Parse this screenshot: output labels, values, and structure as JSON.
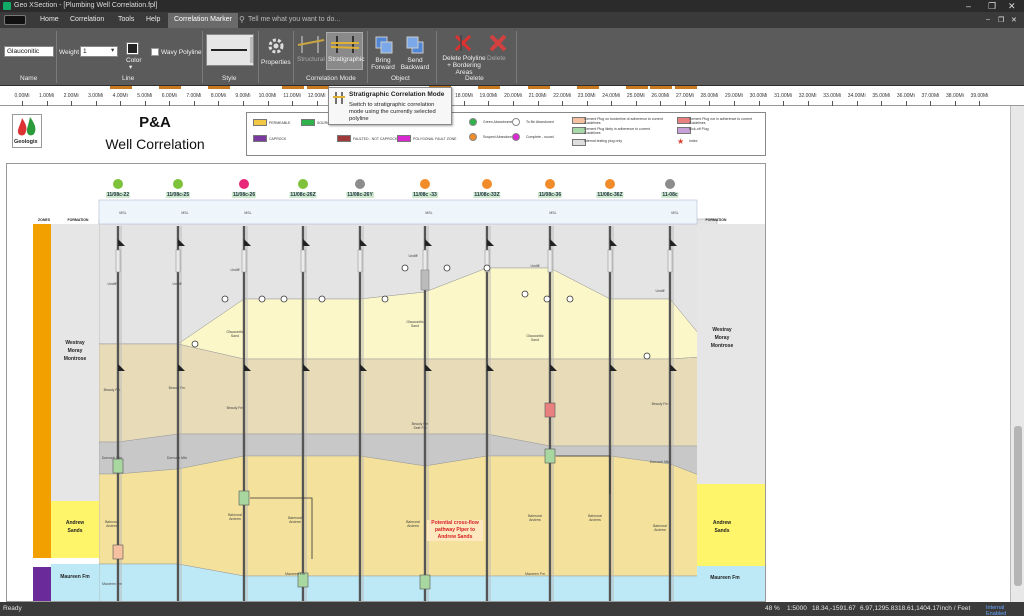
{
  "window": {
    "title": "Geo XSection - [Plumbing Well Correlation.fpl]"
  },
  "menu": {
    "items": [
      "Home",
      "Correlation",
      "Tools",
      "Help"
    ],
    "active_tab": "Correlation Marker",
    "search_placeholder": "Tell me what you want to do..."
  },
  "ribbon": {
    "name_value": "Glauconitic",
    "weight_label": "Weight",
    "weight_value": "1",
    "color_label": "Color",
    "wavy_label": "Wavy Polyline",
    "properties_label": "Properties",
    "structural_label": "Structural",
    "stratigraphic_label": "Stratigraphic",
    "bring_forward_label": "Bring Forward",
    "send_backward_label": "Send Backward",
    "delete_polyline_label": "Delete Polyline + Bordering Areas",
    "delete_label": "Delete",
    "groups": {
      "name": "Name",
      "line": "Line",
      "style": "Style",
      "correlation_mode": "Correlation Mode",
      "object": "Object",
      "delete": "Delete"
    }
  },
  "tooltip": {
    "title": "Stratigraphic Correlation Mode",
    "body": "Switch to stratigraphic correlation mode using the currently selected polyline"
  },
  "ruler": {
    "labels": [
      "0.00Mi",
      "1.00Mi",
      "2.00Mi",
      "3.00Mi",
      "4.00Mi",
      "5.00Mi",
      "6.00Mi",
      "7.00Mi",
      "8.00Mi",
      "9.00Mi",
      "10.00Mi",
      "11.00Mi",
      "12.00Mi",
      "13.00Mi",
      "14.00Mi",
      "15.00Mi",
      "16.00Mi",
      "17.00Mi",
      "18.00Mi",
      "19.00Mi",
      "20.00Mi",
      "21.00Mi",
      "22.00Mi",
      "23.00Mi",
      "24.00Mi",
      "25.00Mi",
      "26.00Mi",
      "27.00Mi",
      "28.00Mi",
      "29.00Mi",
      "30.00Mi",
      "31.00Mi",
      "32.00Mi",
      "33.00Mi",
      "34.00Mi",
      "35.00Mi",
      "36.00Mi",
      "37.00Mi",
      "38.00Mi",
      "39.00Mi"
    ]
  },
  "header": {
    "logo_text": "Geologix",
    "title_line1": "P&A",
    "title_line2": "Well Correlation"
  },
  "legend": {
    "items": [
      "PERMEABLE",
      "SOURCE",
      "CAPROCK",
      "FAULTED - NOT CAPROCK",
      "POLYGONAL FAULT ZONE",
      "Green Abandonment",
      "To Be Abandoned",
      "Suspect Abandonment",
      "Complete - sound",
      "Cement Plug on borderline of adherence to current Guidelines",
      "Cement Plug likely in adherence to current Guidelines",
      "Internal testing plug only",
      "Cement Plug not in adherence to current Guidelines",
      "Kick-off Plug",
      "Index"
    ]
  },
  "section": {
    "zones_header": "ZONES",
    "formation_header": "FORMATION",
    "formation_header_right": "FORMATION",
    "wells": [
      {
        "name": "11/08c-22",
        "status_color": "#7dc23a"
      },
      {
        "name": "11/08c-25",
        "status_color": "#7dc23a"
      },
      {
        "name": "11/08c-26",
        "status_color": "#e8267a"
      },
      {
        "name": "11/08c-26Z",
        "status_color": "#7dc23a"
      },
      {
        "name": "11/08c-26Y",
        "status_color": "#8c8c8c"
      },
      {
        "name": "11/08c -33",
        "status_color": "#f08c2a"
      },
      {
        "name": "11/08c-33Z",
        "status_color": "#f08c2a"
      },
      {
        "name": "11/08c-36",
        "status_color": "#f08c2a"
      },
      {
        "name": "11/08c-36Z",
        "status_color": "#f08c2a"
      },
      {
        "name": "11-08c",
        "status_color": "#8c8c8c"
      }
    ],
    "zone_left_1": "Westray\nMoray\nMontrose",
    "zone_left_2": "Andrew\nSands",
    "zone_left_3": "Maureen Fm",
    "zone_right_1": "Westray\nMoray\nMontrose",
    "zone_right_2": "Andrew\nSands",
    "zone_right_3": "Maureen Fm",
    "annotation": "Potential cross-flow pathway Piper to Andrew Sands",
    "labels": {
      "upper": "Undiff",
      "glauc": "Glauconitic Sand",
      "beauly": "Beauly Fm",
      "dornoch": "Dornoch Mbr",
      "balmoral": "Balmoral Andrew",
      "maureen": "Maureen Fm",
      "sele": "Sele Fm",
      "msl": "MSL"
    }
  },
  "status": {
    "left": "Ready",
    "zoom": "48 %",
    "scale": "1:5000",
    "coords1": "18.34,-1591.67",
    "coords2": "6.97,1295.83",
    "coords3": "18.61,1404.17",
    "units": "inch / Feet",
    "right": "Internal Enabled"
  },
  "colors": {
    "permeable": "#f2c845",
    "source": "#2fb24a",
    "caprock": "#7a3aa0",
    "faulted": "#a03a3a",
    "polygonal": "#d828d0",
    "upper_fill": "#e4e4e4",
    "glauc_fill": "#fbf7c8",
    "beauly_fill": "#e8dcb8",
    "dornoch_fill": "#c8c8c8",
    "andrew_fill": "#f4e29c",
    "maureen_fill": "#bde8f5"
  }
}
